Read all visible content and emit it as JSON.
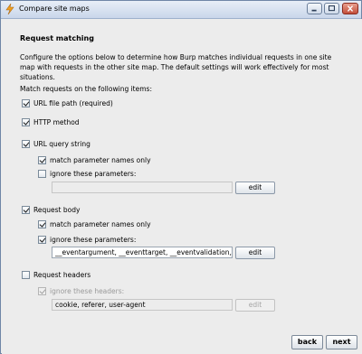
{
  "window": {
    "title": "Compare site maps"
  },
  "heading": "Request matching",
  "description": "Configure the options below to determine how Burp matches individual requests in one site map with requests in the other site map. The default settings will work effectively for most situations.",
  "match_label": "Match requests on the following items:",
  "items": {
    "url_file_path": {
      "label": "URL file path (required)",
      "checked": true
    },
    "http_method": {
      "label": "HTTP method",
      "checked": true
    },
    "url_query_string": {
      "label": "URL query string",
      "checked": true,
      "match_names_only": {
        "label": "match parameter names only",
        "checked": true
      },
      "ignore_params": {
        "label": "ignore these parameters:",
        "checked": false,
        "value": ""
      }
    },
    "request_body": {
      "label": "Request body",
      "checked": true,
      "match_names_only": {
        "label": "match parameter names only",
        "checked": true
      },
      "ignore_params": {
        "label": "ignore these parameters:",
        "checked": true,
        "value": "__eventargument, __eventtarget, __eventvalidation, __viewstate"
      }
    },
    "request_headers": {
      "label": "Request headers",
      "checked": false,
      "ignore_headers": {
        "label": "ignore these headers:",
        "checked": true,
        "value": "cookie, referer, user-agent"
      }
    }
  },
  "buttons": {
    "edit": "edit",
    "back": "back",
    "next": "next"
  },
  "colors": {
    "titlebar": "#c9d6ea",
    "close": "#c24e3a",
    "panel": "#ececec"
  }
}
